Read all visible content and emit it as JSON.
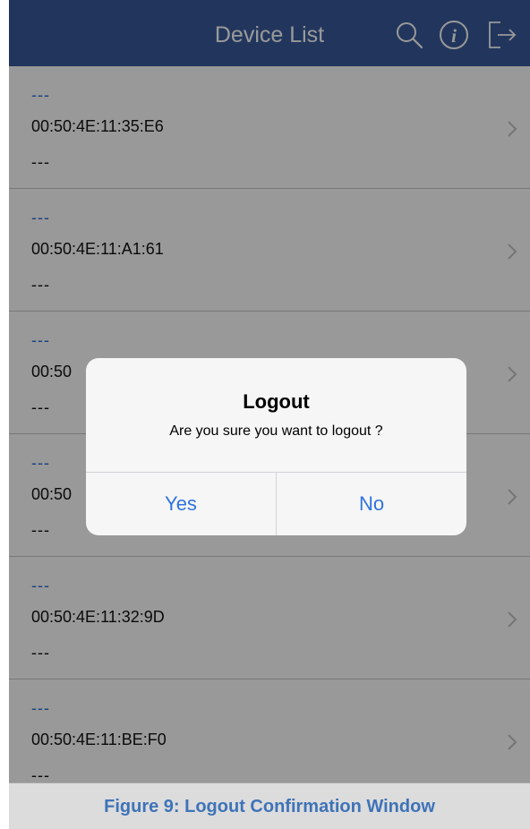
{
  "header": {
    "title": "Device List",
    "background_color": "#395b9c",
    "icons": [
      "search-icon",
      "info-icon",
      "logout-icon"
    ]
  },
  "devices": [
    {
      "name": "---",
      "mac": "00:50:4E:11:35:E6",
      "detail": "---"
    },
    {
      "name": "---",
      "mac": "00:50:4E:11:A1:61",
      "detail": "---"
    },
    {
      "name": "---",
      "mac": "00:50",
      "detail": "---"
    },
    {
      "name": "---",
      "mac": "00:50",
      "detail": "---"
    },
    {
      "name": "---",
      "mac": "00:50:4E:11:32:9D",
      "detail": "---"
    },
    {
      "name": "---",
      "mac": "00:50:4E:11:BE:F0",
      "detail": "---"
    }
  ],
  "dialog": {
    "title": "Logout",
    "message": "Are you sure you want to logout ?",
    "yes_label": "Yes",
    "no_label": "No",
    "button_color": "#2f73e0"
  },
  "caption": {
    "text": "Figure 9: Logout Confirmation Window",
    "color": "#3e73b8"
  }
}
